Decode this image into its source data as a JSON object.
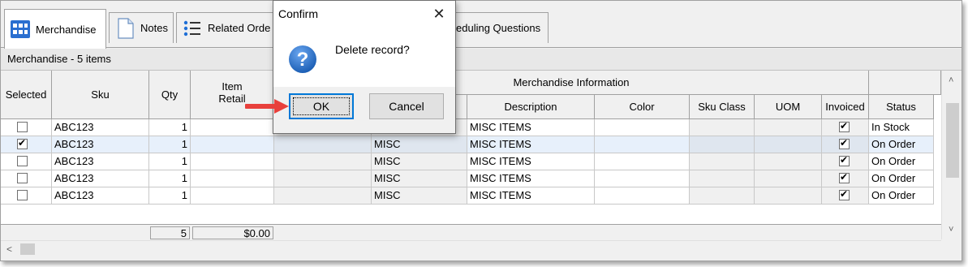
{
  "tabs": [
    {
      "label": "Merchandise",
      "icon": "grid-icon",
      "active": true
    },
    {
      "label": "Notes",
      "icon": "note-icon",
      "active": false
    },
    {
      "label": "Related Orde",
      "icon": "list-icon",
      "active": false
    },
    {
      "label": "eduling Questions",
      "icon": "",
      "active": false
    }
  ],
  "items_label": "Merchandise - 5 items",
  "grid": {
    "group_header": "Merchandise Information",
    "columns": {
      "selected": "Selected",
      "sku": "Sku",
      "qty": "Qty",
      "item_retail_1": "Item",
      "item_retail_2": "Retail",
      "description": "Description",
      "color": "Color",
      "sku_class": "Sku Class",
      "uom": "UOM",
      "invoiced": "Invoiced",
      "status": "Status"
    },
    "rows": [
      {
        "selected": false,
        "sku": "ABC123",
        "qty": "1",
        "cat": "MISC",
        "description": "MISC ITEMS",
        "invoiced": true,
        "status": "In Stock"
      },
      {
        "selected": true,
        "sku": "ABC123",
        "qty": "1",
        "cat": "MISC",
        "description": "MISC ITEMS",
        "invoiced": true,
        "status": "On Order"
      },
      {
        "selected": false,
        "sku": "ABC123",
        "qty": "1",
        "cat": "MISC",
        "description": "MISC ITEMS",
        "invoiced": true,
        "status": "On Order"
      },
      {
        "selected": false,
        "sku": "ABC123",
        "qty": "1",
        "cat": "MISC",
        "description": "MISC ITEMS",
        "invoiced": true,
        "status": "On Order"
      },
      {
        "selected": false,
        "sku": "ABC123",
        "qty": "1",
        "cat": "MISC",
        "description": "MISC ITEMS",
        "invoiced": true,
        "status": "On Order"
      }
    ],
    "totals": {
      "qty": "5",
      "retail": "$0.00"
    }
  },
  "dialog": {
    "title": "Confirm",
    "message": "Delete record?",
    "ok_label": "OK",
    "cancel_label": "Cancel",
    "close_glyph": "✕"
  },
  "colors": {
    "selected_row": "#e7f0fb",
    "default_button_border": "#0078d7",
    "question_icon": "#1c5fb5",
    "annotation_arrow": "#e8403c"
  }
}
